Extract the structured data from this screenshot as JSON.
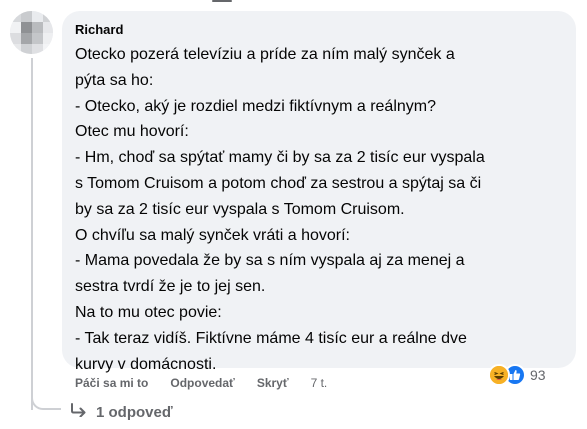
{
  "comment": {
    "author": "Richard",
    "lines": [
      "Otecko pozerá televíziu a príde za ním malý synček a",
      "pýta sa ho:",
      "- Otecko, aký je rozdiel medzi fiktívnym a reálnym?",
      "Otec mu hovorí:",
      "- Hm, choď sa spýtať mamy či by sa za 2 tisíc eur vyspala",
      "s Tomom Cruisom a potom choď za sestrou a spýtaj sa či",
      "by sa za 2 tisíc eur vyspala s Tomom Cruisom.",
      "O chvíľu sa malý synček vráti a hovorí:",
      "- Mama povedala že by sa s ním vyspala aj za menej a",
      "sestra tvrdí že je to jej sen.",
      "Na to mu otec povie:",
      "- Tak teraz vidíš. Fiktívne máme 4 tisíc eur a reálne dve",
      "kurvy v domácnosti."
    ],
    "reactions": {
      "icons": [
        "haha-icon",
        "like-icon"
      ],
      "count": "93"
    },
    "actions": {
      "like": "Páči sa mi to",
      "reply": "Odpovedať",
      "hide": "Skryť",
      "time": "7 t."
    },
    "replies_label": "1 odpoveď"
  },
  "colors": {
    "bubble": "#f0f2f5",
    "text": "#050505",
    "secondary": "#65676b",
    "like_blue": "#1877f2",
    "haha_yellow": "#f7b125"
  }
}
